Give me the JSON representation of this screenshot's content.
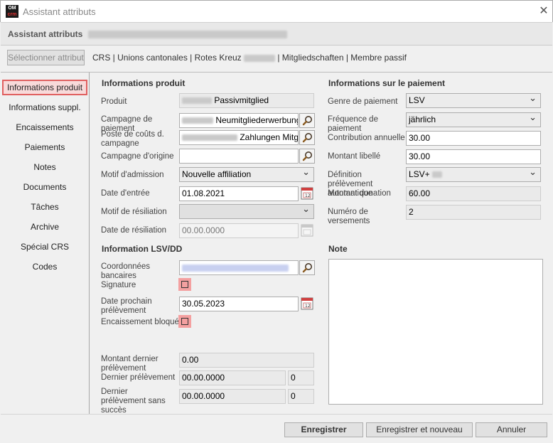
{
  "window": {
    "logo_top": "OM",
    "logo_bottom": "crm",
    "title": "Assistant attributs",
    "close": "✕"
  },
  "header": {
    "title": "Assistant attributs"
  },
  "toolbar": {
    "select_attribute_button": "Sélectionner attribut",
    "breadcrumb_before": "CRS | Unions cantonales | Rotes Kreuz",
    "breadcrumb_after": "| Mitgliedschaften | Membre passif"
  },
  "sidebar": {
    "items": [
      {
        "label": "Informations produit",
        "active": true
      },
      {
        "label": "Informations suppl."
      },
      {
        "label": "Encaissements"
      },
      {
        "label": "Paiements"
      },
      {
        "label": "Notes"
      },
      {
        "label": "Documents"
      },
      {
        "label": "Tâches"
      },
      {
        "label": "Archive"
      },
      {
        "label": "Spécial CRS"
      },
      {
        "label": "Codes"
      }
    ]
  },
  "product_info": {
    "title": "Informations produit",
    "produit_label": "Produit",
    "produit_value": "Passivmitglied",
    "campagne_paiement_label": "Campagne de paiement",
    "campagne_paiement_value": "Neumitgliederwerbung W",
    "poste_couts_label": "Poste de coûts d. campagne",
    "poste_couts_value": "Zahlungen Mitg",
    "campagne_origine_label": "Campagne d'origine",
    "campagne_origine_value": "",
    "motif_admission_label": "Motif d'admission",
    "motif_admission_value": "Nouvelle affiliation",
    "date_entree_label": "Date d'entrée",
    "date_entree_value": "01.08.2021",
    "motif_resiliation_label": "Motif de résiliation",
    "motif_resiliation_value": "",
    "date_resiliation_label": "Date de résiliation",
    "date_resiliation_value": "00.00.0000"
  },
  "lsv": {
    "title": "Information LSV/DD",
    "coordonnees_label": "Coordonnées bancaires",
    "signature_label": "Signature",
    "date_prochain_label": "Date prochain prélèvement",
    "date_prochain_value": "30.05.2023",
    "encaissement_bloque_label": "Encaissement bloqué",
    "montant_dernier_label": "Montant dernier prélèvement",
    "montant_dernier_value": "0.00",
    "dernier_prelevement_label": "Dernier prélèvement",
    "dernier_prelevement_date": "00.00.0000",
    "dernier_prelevement_count": "0",
    "dernier_sans_succes_label": "Dernier prélèvement sans succès",
    "dernier_sans_succes_date": "00.00.0000",
    "dernier_sans_succes_count": "0"
  },
  "payment_info": {
    "title": "Informations sur le paiement",
    "genre_label": "Genre de paiement",
    "genre_value": "LSV",
    "frequence_label": "Fréquence de paiement",
    "frequence_value": "jährlich",
    "contribution_label": "Contribution annuelle",
    "contribution_value": "30.00",
    "montant_libelle_label": "Montant libellé",
    "montant_libelle_value": "30.00",
    "definition_label": "Définition prélèvement automatique",
    "definition_value": "LSV+",
    "montant_donation_label": "Montant donation",
    "montant_donation_value": "60.00",
    "numero_versements_label": "Numéro de versements",
    "numero_versements_value": "2"
  },
  "note": {
    "title": "Note",
    "value": ""
  },
  "footer": {
    "save": "Enregistrer",
    "save_new": "Enregistrer et nouveau",
    "cancel": "Annuler"
  },
  "colors": {
    "active_highlight": "#e06060",
    "checkbox_highlight": "#f4a0a0"
  }
}
